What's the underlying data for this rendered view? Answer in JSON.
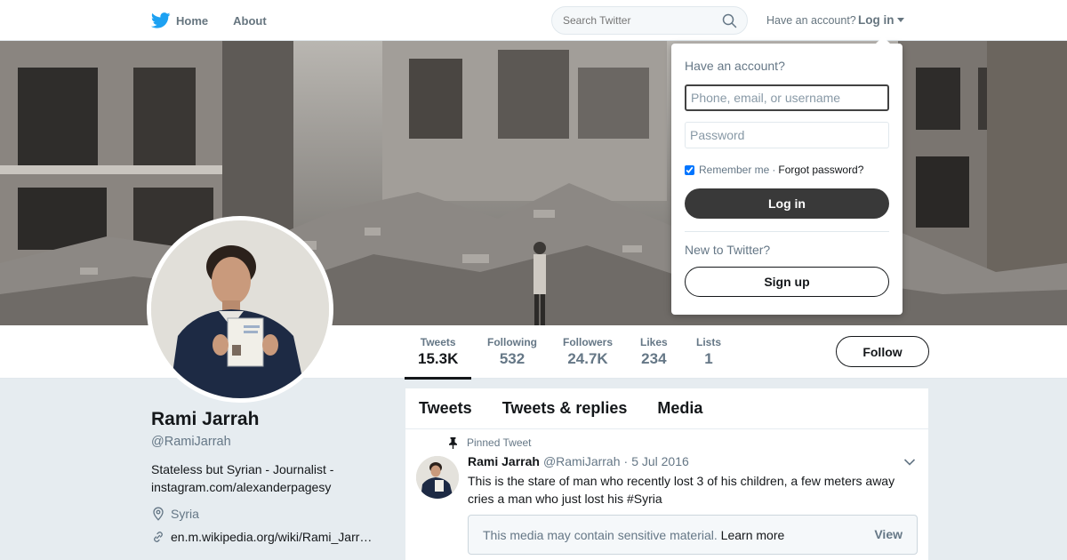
{
  "nav": {
    "home_label": "Home",
    "about_label": "About",
    "search_placeholder": "Search Twitter",
    "have_account": "Have an account?",
    "login_label": "Log in"
  },
  "profile": {
    "name": "Rami Jarrah",
    "handle": "@RamiJarrah",
    "bio": "Stateless but Syrian - Journalist - instagram.com/alexanderpagesy",
    "location": "Syria",
    "website": "en.m.wikipedia.org/wiki/Rami_Jarr…"
  },
  "stats": [
    {
      "label": "Tweets",
      "value": "15.3K"
    },
    {
      "label": "Following",
      "value": "532"
    },
    {
      "label": "Followers",
      "value": "24.7K"
    },
    {
      "label": "Likes",
      "value": "234"
    },
    {
      "label": "Lists",
      "value": "1"
    }
  ],
  "follow_label": "Follow",
  "timeline": {
    "tabs": [
      "Tweets",
      "Tweets & replies",
      "Media"
    ],
    "pinned_label": "Pinned Tweet",
    "tweet": {
      "name": "Rami Jarrah",
      "handle": "@RamiJarrah",
      "dot": "·",
      "date": "5 Jul 2016",
      "text": "This is the stare of man who recently lost 3 of his children, a few meters away cries a man who just lost his #Syria",
      "sensitive_msg": "This media may contain sensitive material.",
      "learn_more": "Learn more",
      "view_label": "View"
    }
  },
  "login": {
    "title": "Have an account?",
    "username_placeholder": "Phone, email, or username",
    "password_placeholder": "Password",
    "remember_label": "Remember me",
    "separator": "·",
    "forgot_label": "Forgot password?",
    "login_button": "Log in",
    "new_label": "New to Twitter?",
    "signup_button": "Sign up"
  },
  "colors": {
    "twitter_blue": "#1da1f2",
    "text_dark": "#14171a",
    "text_gray": "#657786",
    "page_bg": "#e6ecf0"
  }
}
